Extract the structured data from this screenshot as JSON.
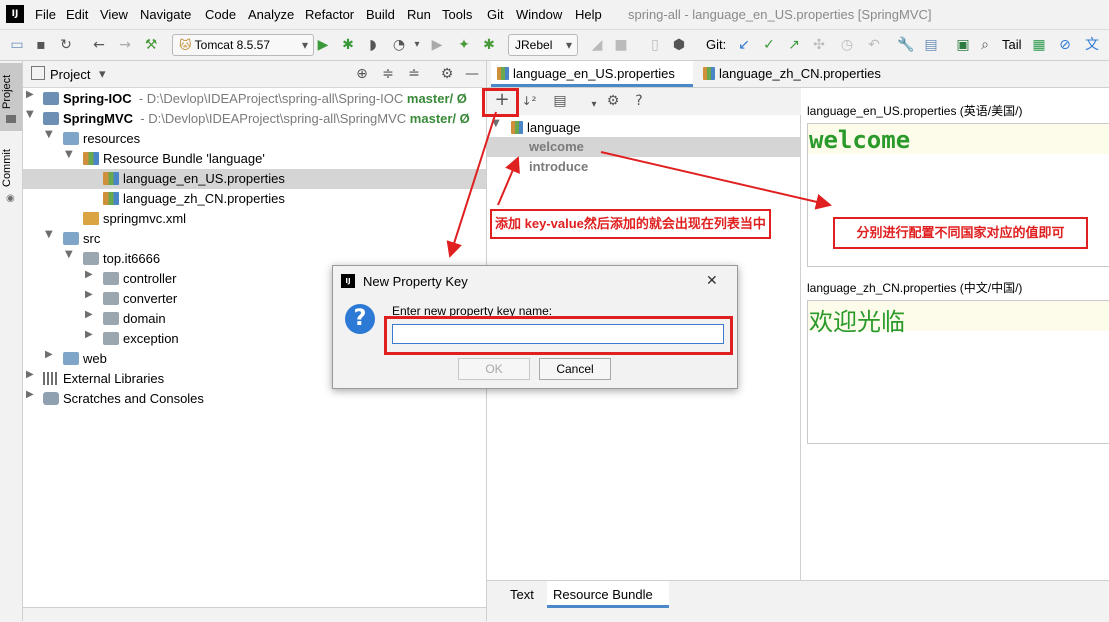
{
  "window": {
    "title": "spring-all - language_en_US.properties [SpringMVC]",
    "logo": "IJ"
  },
  "menu": [
    "File",
    "Edit",
    "View",
    "Navigate",
    "Code",
    "Analyze",
    "Refactor",
    "Build",
    "Run",
    "Tools",
    "Git",
    "Window",
    "Help"
  ],
  "toolbar": {
    "run_config": "Tomcat 8.5.57",
    "jrebel": "JRebel",
    "git_label": "Git:",
    "tail_label": "Tail"
  },
  "side_tabs": {
    "project": "Project",
    "commit": "Commit"
  },
  "project_panel": {
    "header": "Project",
    "tree": [
      {
        "label": "Spring-IOC",
        "path": "- D:\\Devlop\\IDEAProject\\spring-all\\Spring-IOC",
        "branch": "master/",
        "sync": "Ø"
      },
      {
        "label": "SpringMVC",
        "path": "- D:\\Devlop\\IDEAProject\\spring-all\\SpringMVC",
        "branch": "master/",
        "sync": "Ø"
      },
      {
        "label": "resources"
      },
      {
        "label": "Resource Bundle 'language'"
      },
      {
        "label": "language_en_US.properties"
      },
      {
        "label": "language_zh_CN.properties"
      },
      {
        "label": "springmvc.xml"
      },
      {
        "label": "src"
      },
      {
        "label": "top.it6666"
      },
      {
        "label": "controller"
      },
      {
        "label": "converter"
      },
      {
        "label": "domain"
      },
      {
        "label": "exception"
      },
      {
        "label": "web"
      },
      {
        "label": "External Libraries"
      },
      {
        "label": "Scratches and Consoles"
      }
    ]
  },
  "editor_tabs": [
    "language_en_US.properties",
    "language_zh_CN.properties"
  ],
  "bundle_tree": {
    "root": "language",
    "keys": [
      "welcome",
      "introduce"
    ]
  },
  "values": {
    "en_label": "language_en_US.properties (英语/美国/)",
    "en_value": "welcome",
    "zh_label": "language_zh_CN.properties (中文/中国/)",
    "zh_value": "欢迎光临"
  },
  "bottom_tabs": [
    "Text",
    "Resource Bundle"
  ],
  "dialog": {
    "title": "New Property Key",
    "prompt": "Enter new property key name:",
    "input_value": "",
    "ok_label": "OK",
    "cancel_label": "Cancel",
    "close": "✕"
  },
  "annotations": {
    "note_left": "添加 key-value然后添加的就会出现在列表当中",
    "note_right": "分别进行配置不同国家对应的值即可",
    "color": "#e02020"
  }
}
